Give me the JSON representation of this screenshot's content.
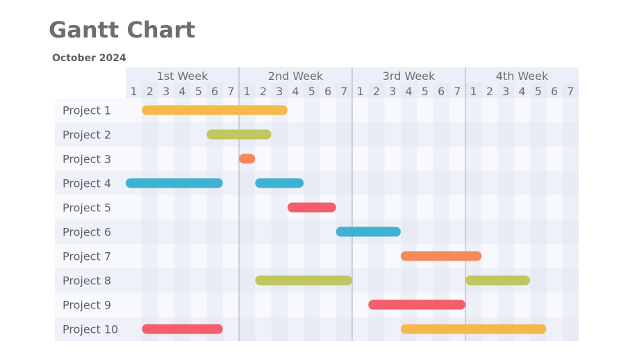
{
  "chart_data": {
    "type": "gantt",
    "title": "Gantt Chart",
    "subtitle": "October 2024",
    "weeks": [
      "1st Week",
      "2nd Week",
      "3rd Week",
      "4th Week"
    ],
    "days_per_week": 7,
    "day_labels": [
      "1",
      "2",
      "3",
      "4",
      "5",
      "6",
      "7"
    ],
    "rows": [
      {
        "label": "Project 1",
        "tasks": [
          {
            "start": 1,
            "end": 10,
            "color": "#f5b94a"
          }
        ]
      },
      {
        "label": "Project 2",
        "tasks": [
          {
            "start": 5,
            "end": 9,
            "color": "#c1c65e"
          }
        ]
      },
      {
        "label": "Project 3",
        "tasks": [
          {
            "start": 7,
            "end": 8,
            "color": "#f58a58"
          }
        ]
      },
      {
        "label": "Project 4",
        "tasks": [
          {
            "start": 0,
            "end": 6,
            "color": "#3fb1d3"
          },
          {
            "start": 8,
            "end": 11,
            "color": "#3fb1d3"
          }
        ]
      },
      {
        "label": "Project 5",
        "tasks": [
          {
            "start": 10,
            "end": 13,
            "color": "#f45e6a"
          }
        ]
      },
      {
        "label": "Project 6",
        "tasks": [
          {
            "start": 13,
            "end": 17,
            "color": "#3fb1d3"
          }
        ]
      },
      {
        "label": "Project 7",
        "tasks": [
          {
            "start": 17,
            "end": 22,
            "color": "#f58a58"
          }
        ]
      },
      {
        "label": "Project 8",
        "tasks": [
          {
            "start": 8,
            "end": 14,
            "color": "#c1c65e"
          },
          {
            "start": 21,
            "end": 25,
            "color": "#c1c65e"
          }
        ]
      },
      {
        "label": "Project 9",
        "tasks": [
          {
            "start": 15,
            "end": 21,
            "color": "#f45e6a"
          }
        ]
      },
      {
        "label": "Project 10",
        "tasks": [
          {
            "start": 1,
            "end": 6,
            "color": "#f45e6a"
          },
          {
            "start": 17,
            "end": 26,
            "color": "#f5b94a"
          }
        ]
      }
    ],
    "units": "day index from start of 1st Week (0–28)"
  }
}
